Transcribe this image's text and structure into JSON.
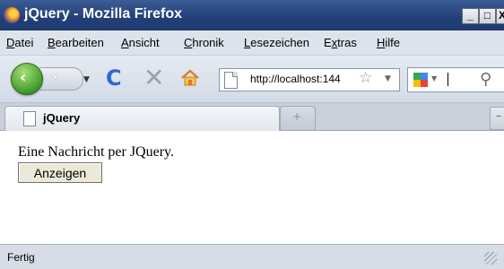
{
  "window": {
    "title": "jQuery - Mozilla Firefox",
    "controls": {
      "minimize": "_",
      "maximize": "□",
      "close": "X"
    }
  },
  "menubar": {
    "items": [
      {
        "label": "Datei",
        "accel": "D",
        "rest": "atei"
      },
      {
        "label": "Bearbeiten",
        "accel": "B",
        "rest": "earbeiten"
      },
      {
        "label": "Ansicht",
        "accel": "A",
        "rest": "nsicht"
      },
      {
        "label": "Chronik",
        "accel": "C",
        "rest": "hronik"
      },
      {
        "label": "Lesezeichen",
        "accel": "L",
        "rest": "esezeichen"
      },
      {
        "label": "Extras",
        "pre": "E",
        "accel": "x",
        "rest": "tras"
      },
      {
        "label": "Hilfe",
        "accel": "H",
        "rest": "ilfe"
      }
    ]
  },
  "navbar": {
    "url": "http://localhost:144",
    "icons": [
      "back-icon",
      "forward-icon",
      "reload-icon",
      "stop-icon",
      "home-icon",
      "bookmark-star-icon",
      "google-icon",
      "search-icon"
    ]
  },
  "tabs": [
    {
      "label": "jQuery",
      "active": true
    }
  ],
  "content": {
    "message": "Eine Nachricht per JQuery.",
    "button_label": "Anzeigen"
  },
  "status": {
    "text": "Fertig"
  },
  "colors": {
    "titlebar": "#223f78",
    "back_button": "#3f9a2a",
    "reload": "#2c66d6"
  }
}
